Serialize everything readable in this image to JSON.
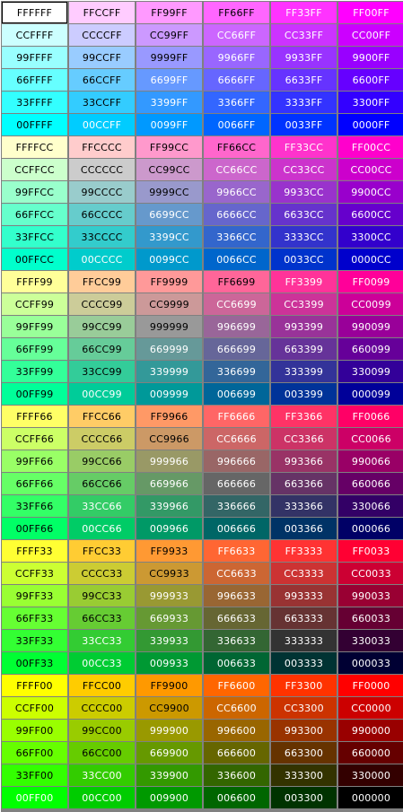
{
  "palette": {
    "colors": [
      [
        "FFFFFF",
        "FFCCFF",
        "FF99FF",
        "FF66FF",
        "FF33FF",
        "FF00FF"
      ],
      [
        "CCFFFF",
        "CCCCFF",
        "CC99FF",
        "CC66FF",
        "CC33FF",
        "CC00FF"
      ],
      [
        "99FFFF",
        "99CCFF",
        "9999FF",
        "9966FF",
        "9933FF",
        "9900FF"
      ],
      [
        "66FFFF",
        "66CCFF",
        "6699FF",
        "6666FF",
        "6633FF",
        "6600FF"
      ],
      [
        "33FFFF",
        "33CCFF",
        "3399FF",
        "3366FF",
        "3333FF",
        "3300FF"
      ],
      [
        "00FFFF",
        "00CCFF",
        "0099FF",
        "0066FF",
        "0033FF",
        "0000FF"
      ],
      [
        "FFFFCC",
        "FFCCCC",
        "FF99CC",
        "FF66CC",
        "FF33CC",
        "FF00CC"
      ],
      [
        "CCFFCC",
        "CCCCCC",
        "CC99CC",
        "CC66CC",
        "CC33CC",
        "CC00CC"
      ],
      [
        "99FFCC",
        "99CCCC",
        "9999CC",
        "9966CC",
        "9933CC",
        "9900CC"
      ],
      [
        "66FFCC",
        "66CCCC",
        "6699CC",
        "6666CC",
        "6633CC",
        "6600CC"
      ],
      [
        "33FFCC",
        "33CCCC",
        "3399CC",
        "3366CC",
        "3333CC",
        "3300CC"
      ],
      [
        "00FFCC",
        "00CCCC",
        "0099CC",
        "0066CC",
        "0033CC",
        "0000CC"
      ],
      [
        "FFFF99",
        "FFCC99",
        "FF9999",
        "FF6699",
        "FF3399",
        "FF0099"
      ],
      [
        "CCFF99",
        "CCCC99",
        "CC9999",
        "CC6699",
        "CC3399",
        "CC0099"
      ],
      [
        "99FF99",
        "99CC99",
        "999999",
        "996699",
        "993399",
        "990099"
      ],
      [
        "66FF99",
        "66CC99",
        "669999",
        "666699",
        "663399",
        "660099"
      ],
      [
        "33FF99",
        "33CC99",
        "339999",
        "336699",
        "333399",
        "330099"
      ],
      [
        "00FF99",
        "00CC99",
        "009999",
        "006699",
        "003399",
        "000099"
      ],
      [
        "FFFF66",
        "FFCC66",
        "FF9966",
        "FF6666",
        "FF3366",
        "FF0066"
      ],
      [
        "CCFF66",
        "CCCC66",
        "CC9966",
        "CC6666",
        "CC3366",
        "CC0066"
      ],
      [
        "99FF66",
        "99CC66",
        "999966",
        "996666",
        "993366",
        "990066"
      ],
      [
        "66FF66",
        "66CC66",
        "669966",
        "666666",
        "663366",
        "660066"
      ],
      [
        "33FF66",
        "33CC66",
        "339966",
        "336666",
        "333366",
        "330066"
      ],
      [
        "00FF66",
        "00CC66",
        "009966",
        "006666",
        "003366",
        "000066"
      ],
      [
        "FFFF33",
        "FFCC33",
        "FF9933",
        "FF6633",
        "FF3333",
        "FF0033"
      ],
      [
        "CCFF33",
        "CCCC33",
        "CC9933",
        "CC6633",
        "CC3333",
        "CC0033"
      ],
      [
        "99FF33",
        "99CC33",
        "999933",
        "996633",
        "993333",
        "990033"
      ],
      [
        "66FF33",
        "66CC33",
        "669933",
        "666633",
        "663333",
        "660033"
      ],
      [
        "33FF33",
        "33CC33",
        "339933",
        "336633",
        "333333",
        "330033"
      ],
      [
        "00FF33",
        "00CC33",
        "009933",
        "006633",
        "003333",
        "000033"
      ],
      [
        "FFFF00",
        "FFCC00",
        "FF9900",
        "FF6600",
        "FF3300",
        "FF0000"
      ],
      [
        "CCFF00",
        "CCCC00",
        "CC9900",
        "CC6600",
        "CC3300",
        "CC0000"
      ],
      [
        "99FF00",
        "99CC00",
        "999900",
        "996600",
        "993300",
        "990000"
      ],
      [
        "66FF00",
        "66CC00",
        "669900",
        "666600",
        "663300",
        "660000"
      ],
      [
        "33FF00",
        "33CC00",
        "339900",
        "336600",
        "333300",
        "330000"
      ],
      [
        "00FF00",
        "00CC00",
        "009900",
        "006600",
        "003300",
        "000000"
      ]
    ],
    "selected": "FFFFFF",
    "label_color_light": "#000000",
    "label_color_dark": "#ffffff"
  }
}
